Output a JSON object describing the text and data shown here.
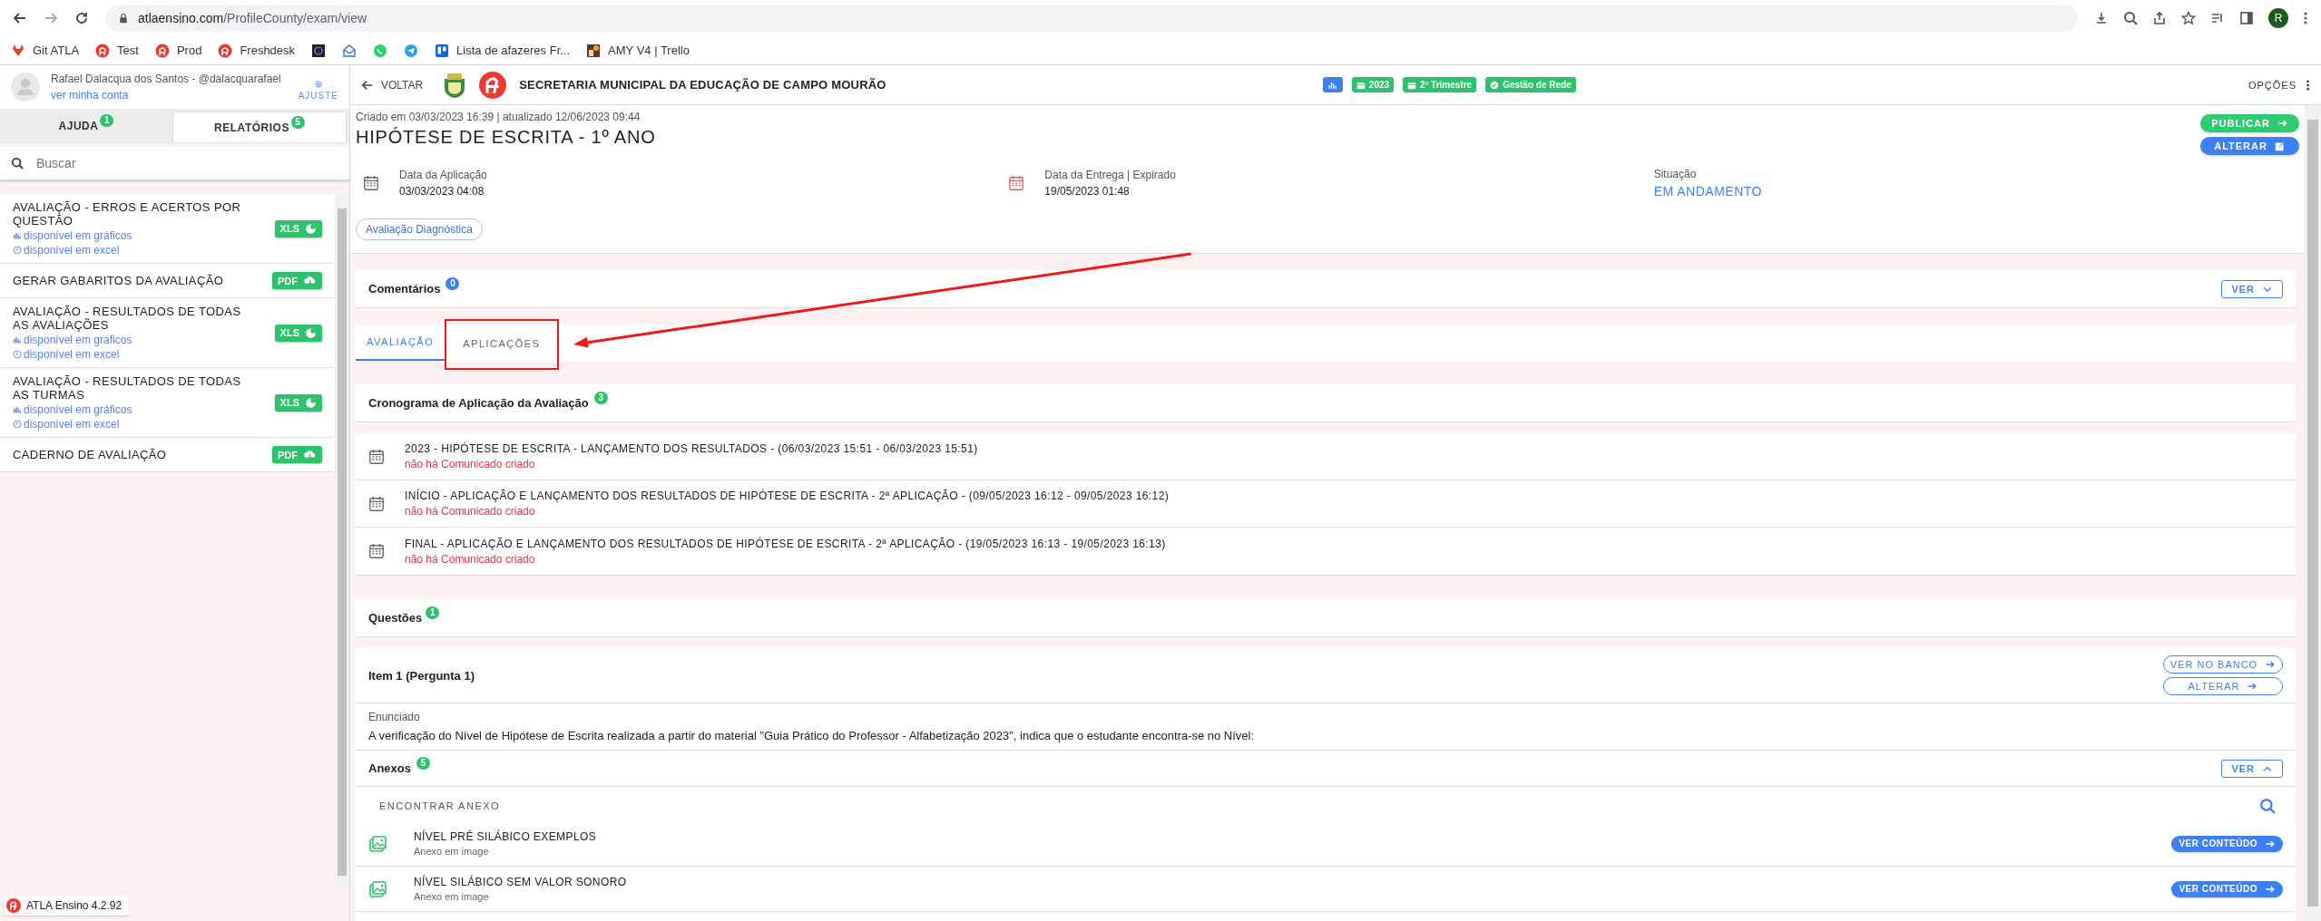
{
  "browser": {
    "url_host": "atlaensino.com",
    "url_path": "/ProfileCounty/exam/view",
    "profile_initial": "R",
    "bookmarks": [
      {
        "kind": "fox",
        "label": "Git ATLA"
      },
      {
        "kind": "atla",
        "label": "Test"
      },
      {
        "kind": "atla",
        "label": "Prod"
      },
      {
        "kind": "atla",
        "label": "Freshdesk"
      },
      {
        "kind": "dark"
      },
      {
        "kind": "mail"
      },
      {
        "kind": "chat"
      },
      {
        "kind": "send"
      },
      {
        "kind": "board",
        "label": "Lista de afazeres Fr..."
      },
      {
        "kind": "photo",
        "label": "AMY V4 | Trello"
      }
    ]
  },
  "sidebar": {
    "user_name": "Rafael Dalacqua dos Santos - @dalacquarafael",
    "account_link": "ver minha conta",
    "settings_label": "AJUSTE",
    "tabs": [
      {
        "label": "AJUDA",
        "count": "1",
        "selected": false
      },
      {
        "label": "RELATÓRIOS",
        "count": "5",
        "selected": true
      }
    ],
    "search": {
      "placeholder": "Buscar"
    },
    "reports": [
      {
        "title": "AVALIAÇÃO - ERROS E ACERTOS POR QUESTÃO",
        "button": "XLS",
        "kind": "xls",
        "links": [
          {
            "kind": "chart",
            "text": "disponível em gráficos"
          },
          {
            "kind": "clock",
            "text": "disponível em excel"
          }
        ]
      },
      {
        "title": "GERAR GABARITOS DA AVALIAÇÃO",
        "button": "PDF",
        "kind": "pdf"
      },
      {
        "title": "AVALIAÇÃO - RESULTADOS DE TODAS AS AVALIAÇÕES",
        "button": "XLS",
        "kind": "xls",
        "links": [
          {
            "kind": "chart",
            "text": "disponível em gráficos"
          },
          {
            "kind": "clock",
            "text": "disponível em excel"
          }
        ]
      },
      {
        "title": "AVALIAÇÃO - RESULTADOS DE TODAS AS TURMAS",
        "button": "XLS",
        "kind": "xls",
        "links": [
          {
            "kind": "chart",
            "text": "disponível em gráficos"
          },
          {
            "kind": "clock",
            "text": "disponível em excel"
          }
        ]
      },
      {
        "title": "CADERNO DE AVALIAÇÃO",
        "button": "PDF",
        "kind": "pdf"
      }
    ],
    "footer": "ATLA Ensino 4.2.92"
  },
  "header": {
    "back": "VOLTAR",
    "organization": "SECRETARIA MUNICIPAL DA EDUCAÇÃO DE CAMPO MOURÃO",
    "options": "OPÇÕES",
    "badges": [
      {
        "kind": "chart"
      },
      {
        "kind": "calendar",
        "label": "2023"
      },
      {
        "kind": "calendar",
        "label": "2º Trimestre"
      },
      {
        "kind": "check",
        "label": "Gestão de Rede"
      }
    ]
  },
  "exam": {
    "meta": "Criado em 03/03/2023 16:39 | atualizado 12/06/2023 09:44",
    "title": "HIPÓTESE DE ESCRITA - 1º ANO",
    "actions": [
      {
        "kind": "publish",
        "label": "PUBLICAR"
      },
      {
        "kind": "edit",
        "label": "ALTERAR"
      }
    ],
    "fields": [
      {
        "kind": "date",
        "label": "Data da Aplicação",
        "value": "03/03/2023 04:08"
      },
      {
        "kind": "date_expired",
        "label": "Data da Entrega | Expirado",
        "value": "19/05/2023 01:48"
      },
      {
        "kind": "status",
        "label": "Situação",
        "value": "EM ANDAMENTO"
      }
    ],
    "tag": "Avaliação Diagnóstica"
  },
  "comments": {
    "title": "Comentários",
    "count": "0",
    "toggle": {
      "label": "VER",
      "expanded": false
    }
  },
  "tabs": [
    {
      "label": "AVALIAÇÃO",
      "selected": true,
      "highlighted": false
    },
    {
      "label": "APLICAÇÕES",
      "selected": false,
      "highlighted": true
    }
  ],
  "annotations": [
    {
      "kind": "arrow"
    }
  ],
  "schedule": {
    "title": "Cronograma de Aplicação da Avaliação",
    "count": "3",
    "items": [
      {
        "title": "2023 - HIPÓTESE DE ESCRITA - LANÇAMENTO DOS RESULTADOS - (06/03/2023 15:51 - 06/03/2023 15:51)",
        "note": "não há Comunicado criado"
      },
      {
        "title": "INÍCIO - APLICAÇÃO E LANÇAMENTO DOS RESULTADOS DE HIPÓTESE DE ESCRITA - 2ª APLICAÇÃO - (09/05/2023 16:12 - 09/05/2023 16:12)",
        "note": "não há Comunicado criado"
      },
      {
        "title": "FINAL - APLICAÇÃO E LANÇAMENTO DOS RESULTADOS DE HIPÓTESE DE ESCRITA - 2ª APLICAÇÃO - (19/05/2023 16:13 - 19/05/2023 16:13)",
        "note": "não há Comunicado criado"
      }
    ]
  },
  "questions": {
    "title": "Questões",
    "count": "1"
  },
  "item": {
    "title": "Item 1 (Pergunta 1)",
    "actions": [
      "VER NO BANCO",
      "ALTERAR"
    ],
    "statement_label": "Enunciado",
    "statement": "A verificação do Nível de Hipótese de Escrita realizada a partir do material \"Guia Prático do Professor - Alfabetização 2023\", indica que o estudante encontra-se no Nível:"
  },
  "attachments": {
    "title": "Anexos",
    "count": "5",
    "toggle": {
      "label": "VER",
      "expanded": true
    },
    "search_label": "ENCONTRAR ANEXO",
    "items": [
      {
        "title": "NÍVEL PRÉ SILÁBICO EXEMPLOS",
        "subtitle": "Anexo em image",
        "action": "VER CONTEÚDO"
      },
      {
        "title": "NÍVEL SILÁBICO SEM VALOR SONORO",
        "subtitle": "Anexo em image",
        "action": "VER CONTEÚDO"
      }
    ]
  }
}
